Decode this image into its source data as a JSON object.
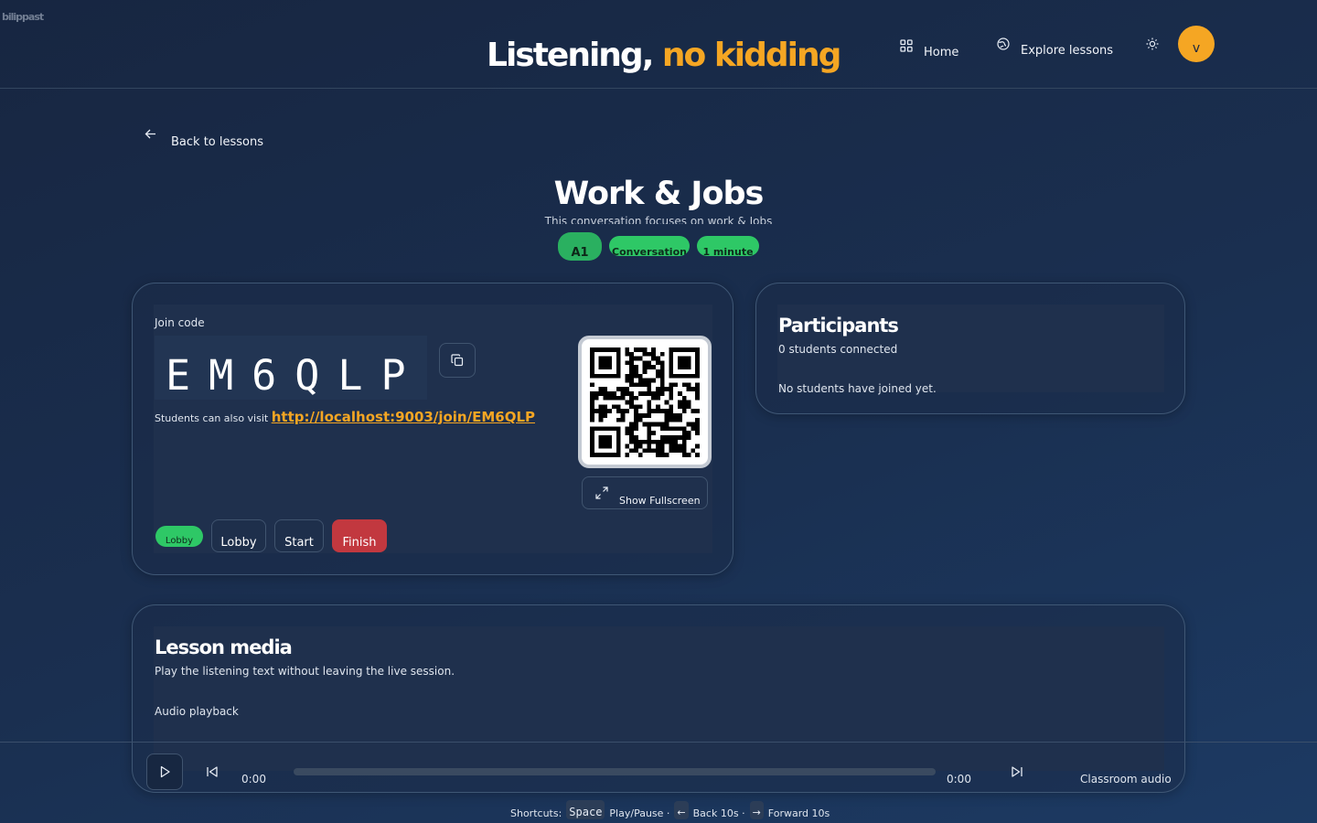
{
  "glitch_text": "bilippast",
  "brand": {
    "primary": "Listening,",
    "accent": "no kidding"
  },
  "nav": {
    "home_label": "Home",
    "explore_label": "Explore lessons",
    "avatar_initial": "v"
  },
  "back_label": "Back to lessons",
  "lesson": {
    "title": "Work & Jobs",
    "subtitle": "This conversation focuses on work & Jobs",
    "tags": [
      "A1",
      "Conversation",
      "1 minute"
    ]
  },
  "session": {
    "join_label": "Join code",
    "code": "EM6QLP",
    "visit_text": "Students can also visit",
    "visit_url": "http://localhost:9003/join/EM6QLP",
    "fullscreen_label": "Show Fullscreen",
    "status": "Lobby",
    "controls": {
      "lobby": "Lobby",
      "start": "Start",
      "finish": "Finish"
    }
  },
  "participants": {
    "title": "Participants",
    "count_text": "0 students connected",
    "empty_text": "No students have joined yet."
  },
  "media": {
    "title": "Lesson media",
    "description": "Play the listening text without leaving the live session.",
    "subheading": "Audio playback"
  },
  "player": {
    "current_time": "0:00",
    "duration": "0:00",
    "progress": 0,
    "audio_label": "Classroom audio"
  },
  "shortcuts": {
    "prefix": "Shortcuts:",
    "space_key": "Space",
    "space_action": "Play/Pause ·",
    "left_key": "←",
    "left_action": "Back 10s ·",
    "right_key": "→",
    "right_action": "Forward 10s"
  },
  "colors": {
    "accent": "#f5a623",
    "success": "#2ec866",
    "danger": "#c2383f",
    "background": "#1a2f50"
  },
  "icons": [
    "grid-icon",
    "globe-icon",
    "sun-icon",
    "arrow-left-icon",
    "copy-icon",
    "expand-icon",
    "play-icon",
    "skip-back-icon",
    "skip-forward-icon",
    "qr-code-icon"
  ]
}
